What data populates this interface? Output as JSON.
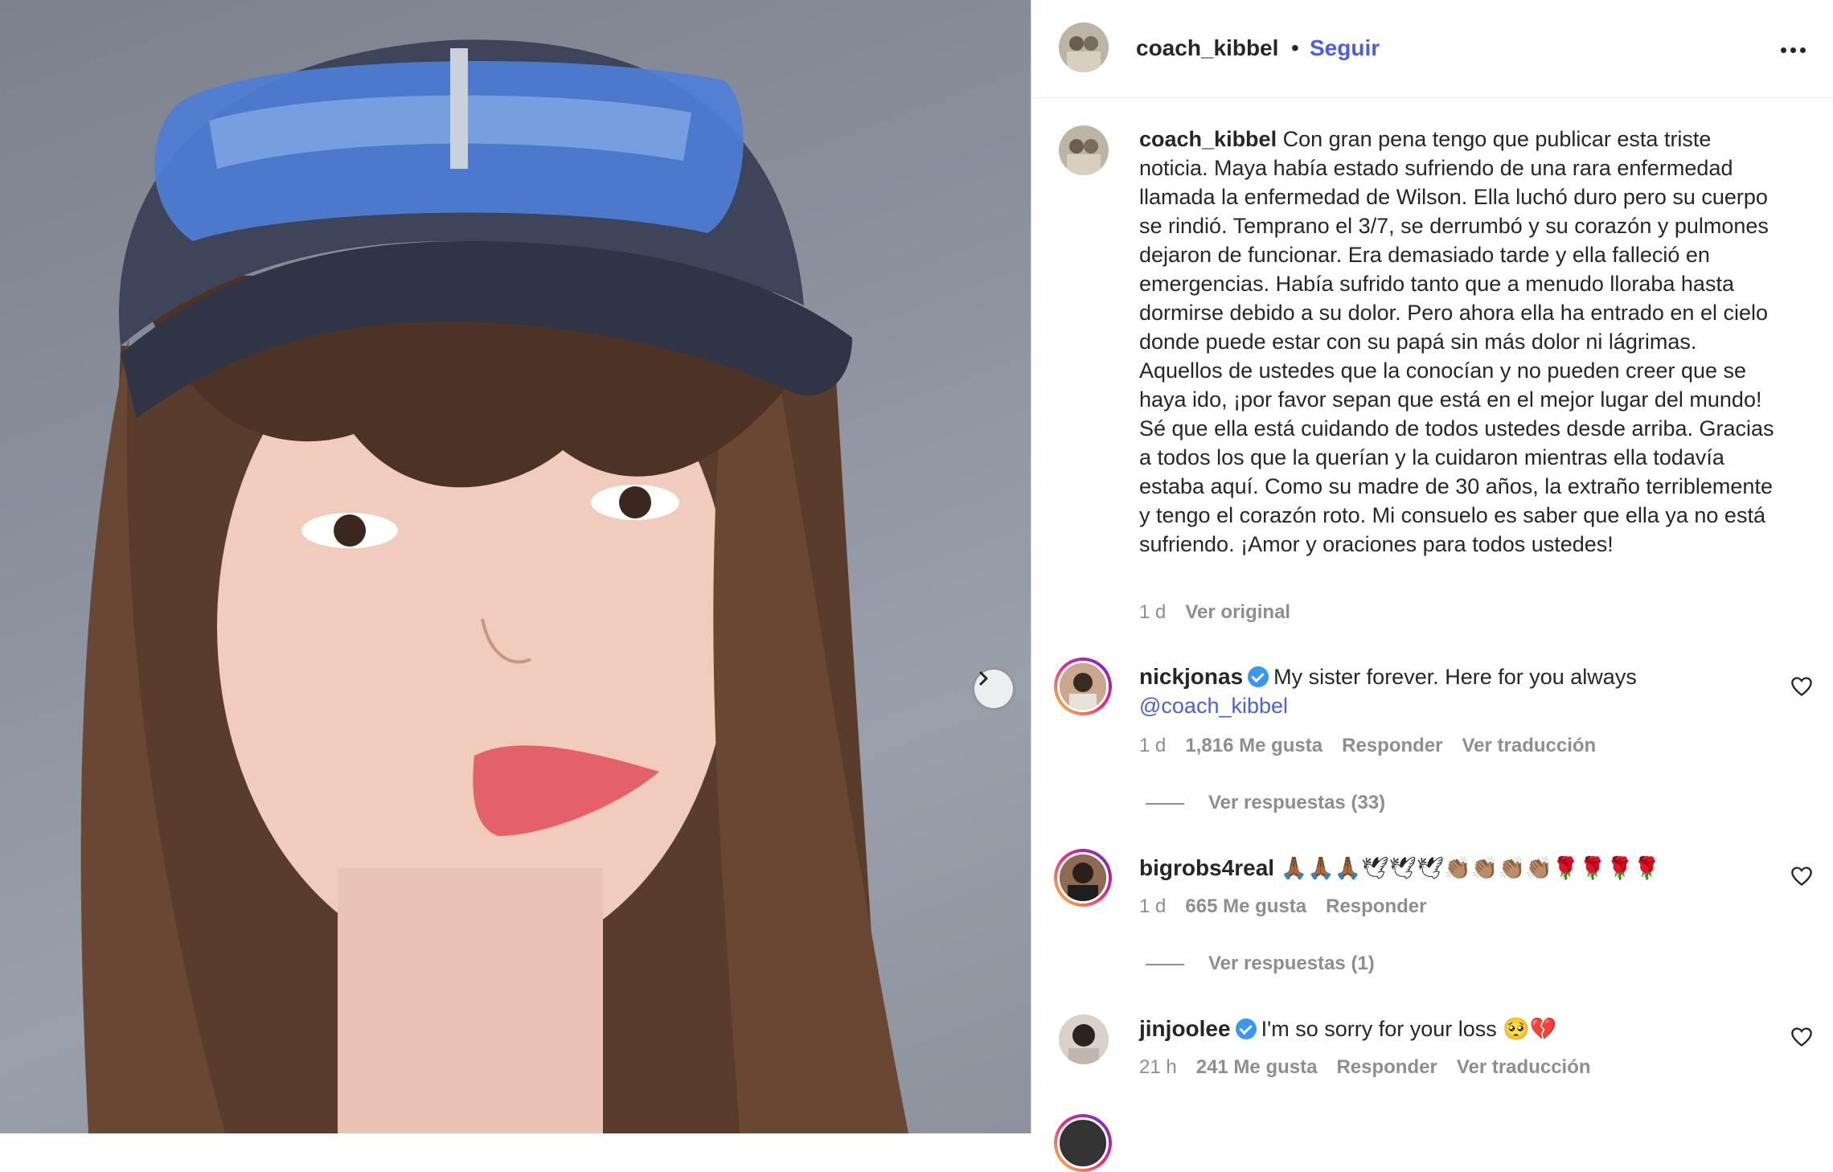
{
  "post": {
    "username": "coach_kibbel",
    "follow_label": "Seguir",
    "separator": "•",
    "caption": "Con gran pena tengo que publicar esta triste noticia. Maya había estado sufriendo de una rara enfermedad llamada la enfermedad de Wilson. Ella luchó duro pero su cuerpo se rindió. Temprano el 3/7, se derrumbó y su corazón y pulmones dejaron de funcionar. Era demasiado tarde y ella falleció en emergencias. Había sufrido tanto que a menudo lloraba hasta dormirse debido a su dolor. Pero ahora ella ha entrado en el cielo donde puede estar con su papá sin más dolor ni lágrimas. Aquellos de ustedes que la conocían y no pueden creer que se haya ido, ¡por favor sepan que está en el mejor lugar del mundo! Sé que ella está cuidando de todos ustedes desde arriba. Gracias a todos los que la querían y la cuidaron mientras ella todavía estaba aquí. Como su madre de 30 años, la extraño terriblemente y tengo el corazón roto. Mi consuelo es saber que ella ya no está sufriendo. ¡Amor y oraciones para todos ustedes!",
    "time": "1 d",
    "see_original": "Ver original"
  },
  "comments": [
    {
      "username": "nickjonas",
      "verified": true,
      "text": "My sister forever. Here for you always",
      "mention": "@coach_kibbel",
      "time": "1 d",
      "likes": "1,816 Me gusta",
      "reply": "Responder",
      "translate": "Ver traducción",
      "view_replies": "Ver respuestas (33)"
    },
    {
      "username": "bigrobs4real",
      "verified": false,
      "text": "🙏🏾🙏🏾🙏🏾🕊🕊🕊👏🏽👏🏽👏🏽👏🏽🌹🌹🌹🌹",
      "time": "1 d",
      "likes": "665 Me gusta",
      "reply": "Responder",
      "view_replies": "Ver respuestas (1)"
    },
    {
      "username": "jinjoolee",
      "verified": true,
      "text": "I'm so sorry for your loss 🥺💔",
      "time": "21 h",
      "likes": "241 Me gusta",
      "reply": "Responder",
      "translate": "Ver traducción"
    }
  ],
  "icons": {
    "more": "more-options-icon",
    "next": "chevron-right-icon",
    "heart": "heart-outline-icon",
    "verified": "verified-badge-icon"
  },
  "colors": {
    "link": "#4a5ee0",
    "muted": "#8e8e8e",
    "text": "#262626",
    "verified": "#3897f0"
  }
}
